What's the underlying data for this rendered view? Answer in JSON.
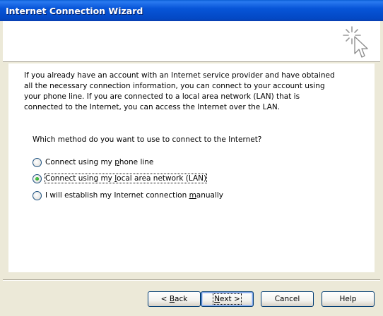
{
  "window": {
    "title": "Internet Connection Wizard"
  },
  "header": {
    "icon": "wizard-sparkle-cursor-icon"
  },
  "intro": {
    "text": "If you already have an account with an Internet service provider and have obtained all the necessary connection information, you can connect to your account using your phone line. If you are connected to a local area network (LAN) that is connected to the Internet, you can access the Internet over the LAN."
  },
  "question": {
    "text": "Which method do you want to use to connect to the Internet?"
  },
  "options": [
    {
      "label_before": "Connect using my ",
      "label_mnemonic": "p",
      "label_after": "hone line",
      "checked": false
    },
    {
      "label_before": "Connect using my ",
      "label_mnemonic": "l",
      "label_after": "ocal area network (LAN)",
      "checked": true
    },
    {
      "label_before": "I will establish my Internet connection ",
      "label_mnemonic": "m",
      "label_after": "anually",
      "checked": false
    }
  ],
  "buttons": {
    "back_prefix": "< ",
    "back_mnemonic": "B",
    "back_rest": "ack",
    "next_mnemonic": "N",
    "next_rest": "ext >",
    "cancel": "Cancel",
    "help": "Help"
  },
  "colors": {
    "titlebar": "#0755d8",
    "face": "#ece9d8",
    "radio_dot": "#21a121"
  }
}
